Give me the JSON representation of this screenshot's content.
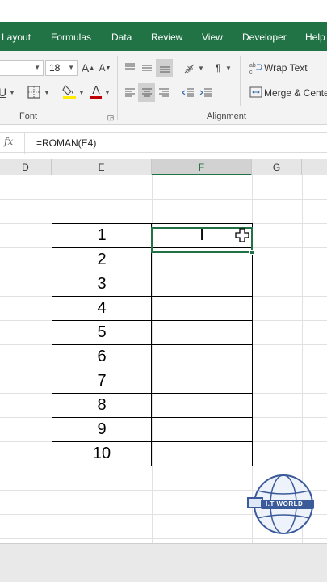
{
  "ribbon_tabs": [
    "Layout",
    "Formulas",
    "Data",
    "Review",
    "View",
    "Developer",
    "Help"
  ],
  "font": {
    "size": "18",
    "group_label": "Font"
  },
  "alignment": {
    "wrap_text": "Wrap Text",
    "merge_center": "Merge & Center",
    "group_label": "Alignment"
  },
  "formula_bar": {
    "fx": "fx",
    "formula": "=ROMAN(E4)"
  },
  "columns": [
    "D",
    "E",
    "F",
    "G"
  ],
  "selected_column": "F",
  "table": {
    "e_values": [
      "1",
      "2",
      "3",
      "4",
      "5",
      "6",
      "7",
      "8",
      "9",
      "10"
    ],
    "f_values": [
      "I",
      "",
      "",
      "",
      "",
      "",
      "",
      "",
      "",
      ""
    ]
  },
  "watermark": "I.T WORLD",
  "colors": {
    "accent": "#217346",
    "font_color": "#c00000",
    "highlight": "#ffeb00"
  }
}
